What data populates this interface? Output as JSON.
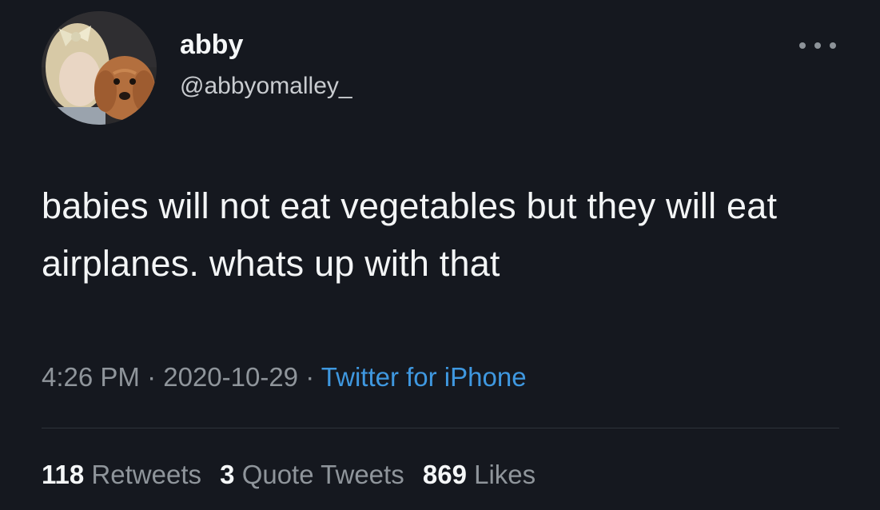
{
  "author": {
    "display_name": "abby",
    "handle": "@abbyomalley_"
  },
  "tweet": {
    "text": "babies will not eat vegetables but they will eat airplanes. whats up with that",
    "time": "4:26 PM",
    "separator1": " · ",
    "date": "2020-10-29",
    "separator2": " · ",
    "source": "Twitter for iPhone"
  },
  "stats": {
    "retweets_count": "118",
    "retweets_label": "Retweets",
    "quotes_count": "3",
    "quotes_label": "Quote Tweets",
    "likes_count": "869",
    "likes_label": "Likes"
  },
  "colors": {
    "background": "#15181f",
    "primary_text": "#f3f5f6",
    "secondary_text": "#8f959b",
    "link": "#3f98e0"
  },
  "icons": {
    "more": "more-horizontal-icon"
  }
}
